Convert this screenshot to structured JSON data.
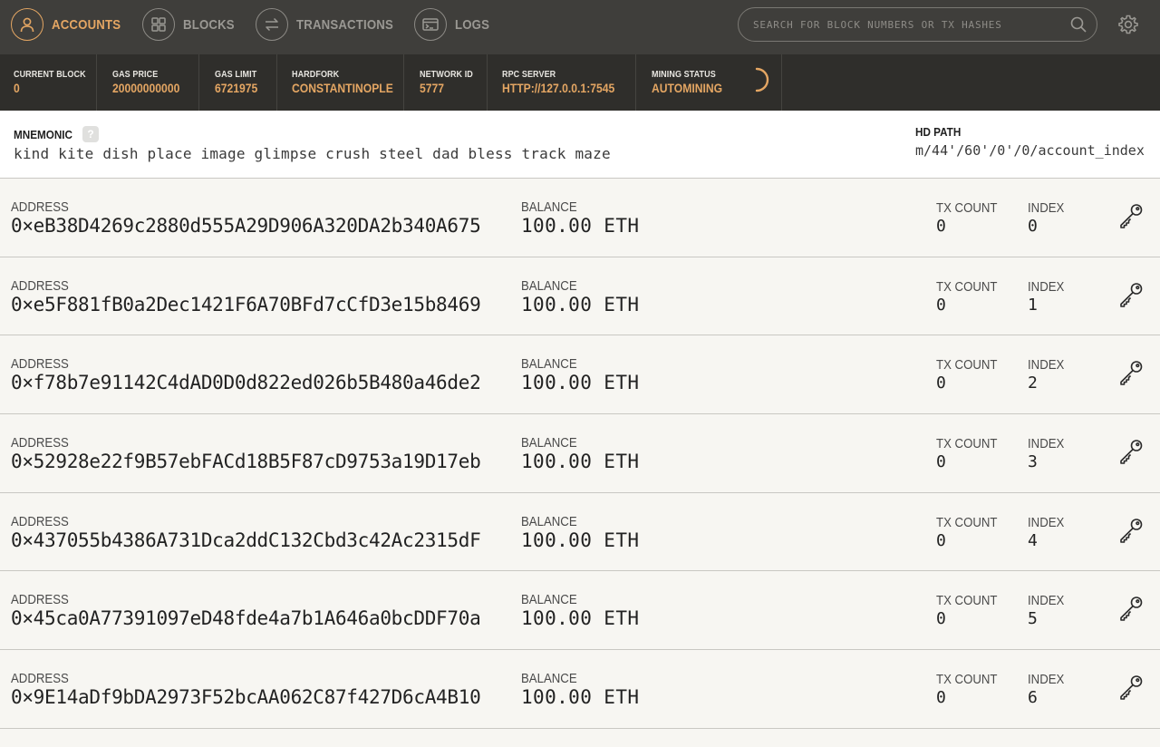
{
  "nav": {
    "items": [
      {
        "label": "ACCOUNTS",
        "icon": "user-icon",
        "active": true
      },
      {
        "label": "BLOCKS",
        "icon": "blocks-icon",
        "active": false
      },
      {
        "label": "TRANSACTIONS",
        "icon": "transfer-icon",
        "active": false
      },
      {
        "label": "LOGS",
        "icon": "terminal-icon",
        "active": false
      }
    ],
    "search_placeholder": "SEARCH FOR BLOCK NUMBERS OR TX HASHES"
  },
  "status": [
    {
      "label": "CURRENT BLOCK",
      "value": "0"
    },
    {
      "label": "GAS PRICE",
      "value": "20000000000"
    },
    {
      "label": "GAS LIMIT",
      "value": "6721975"
    },
    {
      "label": "HARDFORK",
      "value": "CONSTANTINOPLE"
    },
    {
      "label": "NETWORK ID",
      "value": "5777"
    },
    {
      "label": "RPC SERVER",
      "value": "HTTP://127.0.0.1:7545"
    },
    {
      "label": "MINING STATUS",
      "value": "AUTOMINING"
    }
  ],
  "mnemonic": {
    "label": "MNEMONIC",
    "help": "?",
    "words": "kind kite dish place image glimpse crush steel dad bless track maze",
    "hd_label": "HD PATH",
    "hd_path": "m/44'/60'/0'/0/account_index"
  },
  "labels": {
    "address": "ADDRESS",
    "balance": "BALANCE",
    "tx_count": "TX COUNT",
    "index": "INDEX"
  },
  "accounts": [
    {
      "address": "0×eB38D4269c2880d555A29D906A320DA2b340A675",
      "balance": "100.00 ETH",
      "tx_count": "0",
      "index": "0"
    },
    {
      "address": "0×e5F881fB0a2Dec1421F6A70BFd7cCfD3e15b8469",
      "balance": "100.00 ETH",
      "tx_count": "0",
      "index": "1"
    },
    {
      "address": "0×f78b7e91142C4dAD0D0d822ed026b5B480a46de2",
      "balance": "100.00 ETH",
      "tx_count": "0",
      "index": "2"
    },
    {
      "address": "0×52928e22f9B57ebFACd18B5F87cD9753a19D17eb",
      "balance": "100.00 ETH",
      "tx_count": "0",
      "index": "3"
    },
    {
      "address": "0×437055b4386A731Dca2ddC132Cbd3c42Ac2315dF",
      "balance": "100.00 ETH",
      "tx_count": "0",
      "index": "4"
    },
    {
      "address": "0×45ca0A77391097eD48fde4a7b1A646a0bcDDF70a",
      "balance": "100.00 ETH",
      "tx_count": "0",
      "index": "5"
    },
    {
      "address": "0×9E14aDf9bDA2973F52bcAA062C87f427D6cA4B10",
      "balance": "100.00 ETH",
      "tx_count": "0",
      "index": "6"
    }
  ],
  "colors": {
    "accent": "#e4a663",
    "nav_bg": "#3f3e3b",
    "status_bg": "#2f2e2b",
    "row_bg": "#f7f6f2"
  }
}
